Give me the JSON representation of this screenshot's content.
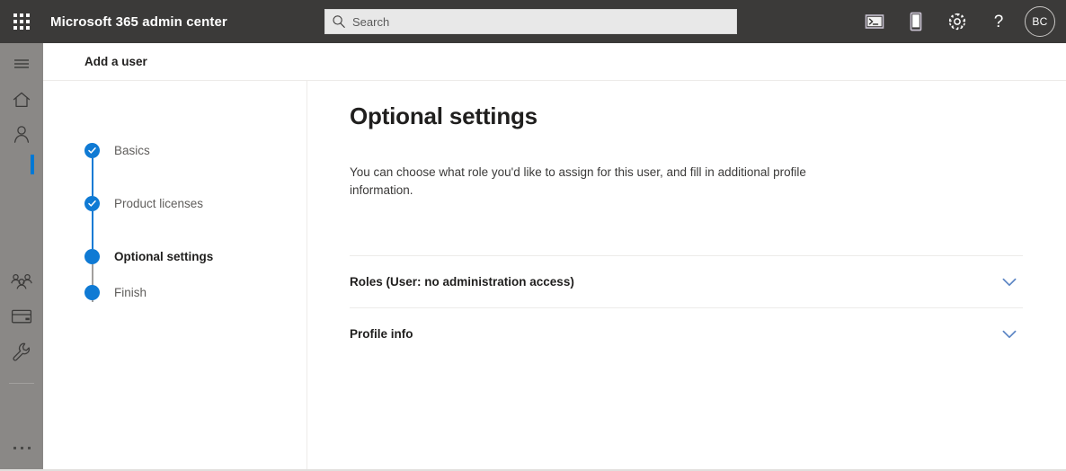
{
  "suitebar": {
    "waffle_label": "app-launcher",
    "brand": "Microsoft 365 admin center",
    "search": {
      "placeholder": "Search",
      "value": ""
    },
    "actions": [
      {
        "name": "console-icon",
        "label": "Console"
      },
      {
        "name": "mobile-icon",
        "label": "Mobile"
      },
      {
        "name": "gear-icon",
        "label": "Settings"
      },
      {
        "name": "help-icon",
        "label": "Help"
      }
    ],
    "avatar_initials": "BC"
  },
  "rail": {
    "items": [
      {
        "name": "hamburger-icon",
        "label": "Menu"
      },
      {
        "name": "home-icon",
        "label": "Home"
      },
      {
        "name": "users-icon",
        "label": "Users"
      },
      {
        "name": "teams-icon",
        "label": "Teams & groups"
      },
      {
        "name": "billing-icon",
        "label": "Billing"
      },
      {
        "name": "wrench-icon",
        "label": "Setup"
      }
    ],
    "more_label": "Show all"
  },
  "page_header": {
    "title": "Add a user"
  },
  "wizard": {
    "steps": [
      {
        "label": "Basics",
        "state": "complete"
      },
      {
        "label": "Product licenses",
        "state": "complete"
      },
      {
        "label": "Optional settings",
        "state": "current"
      },
      {
        "label": "Finish",
        "state": "upcoming"
      }
    ]
  },
  "main": {
    "title": "Optional settings",
    "description": "You can choose what role you'd like to assign for this user, and fill in additional profile information.",
    "sections": [
      {
        "label": "Roles (User: no administration access)",
        "expanded": false
      },
      {
        "label": "Profile info",
        "expanded": false
      }
    ]
  },
  "colors": {
    "suitebar_bg": "#3b3a39",
    "rail_bg": "#8a8886",
    "accent_blue": "#0f7ad4",
    "chevron_blue": "#5b85c4",
    "text_primary": "#201f1e",
    "text_secondary": "#605e5c",
    "border": "#edebe9"
  }
}
